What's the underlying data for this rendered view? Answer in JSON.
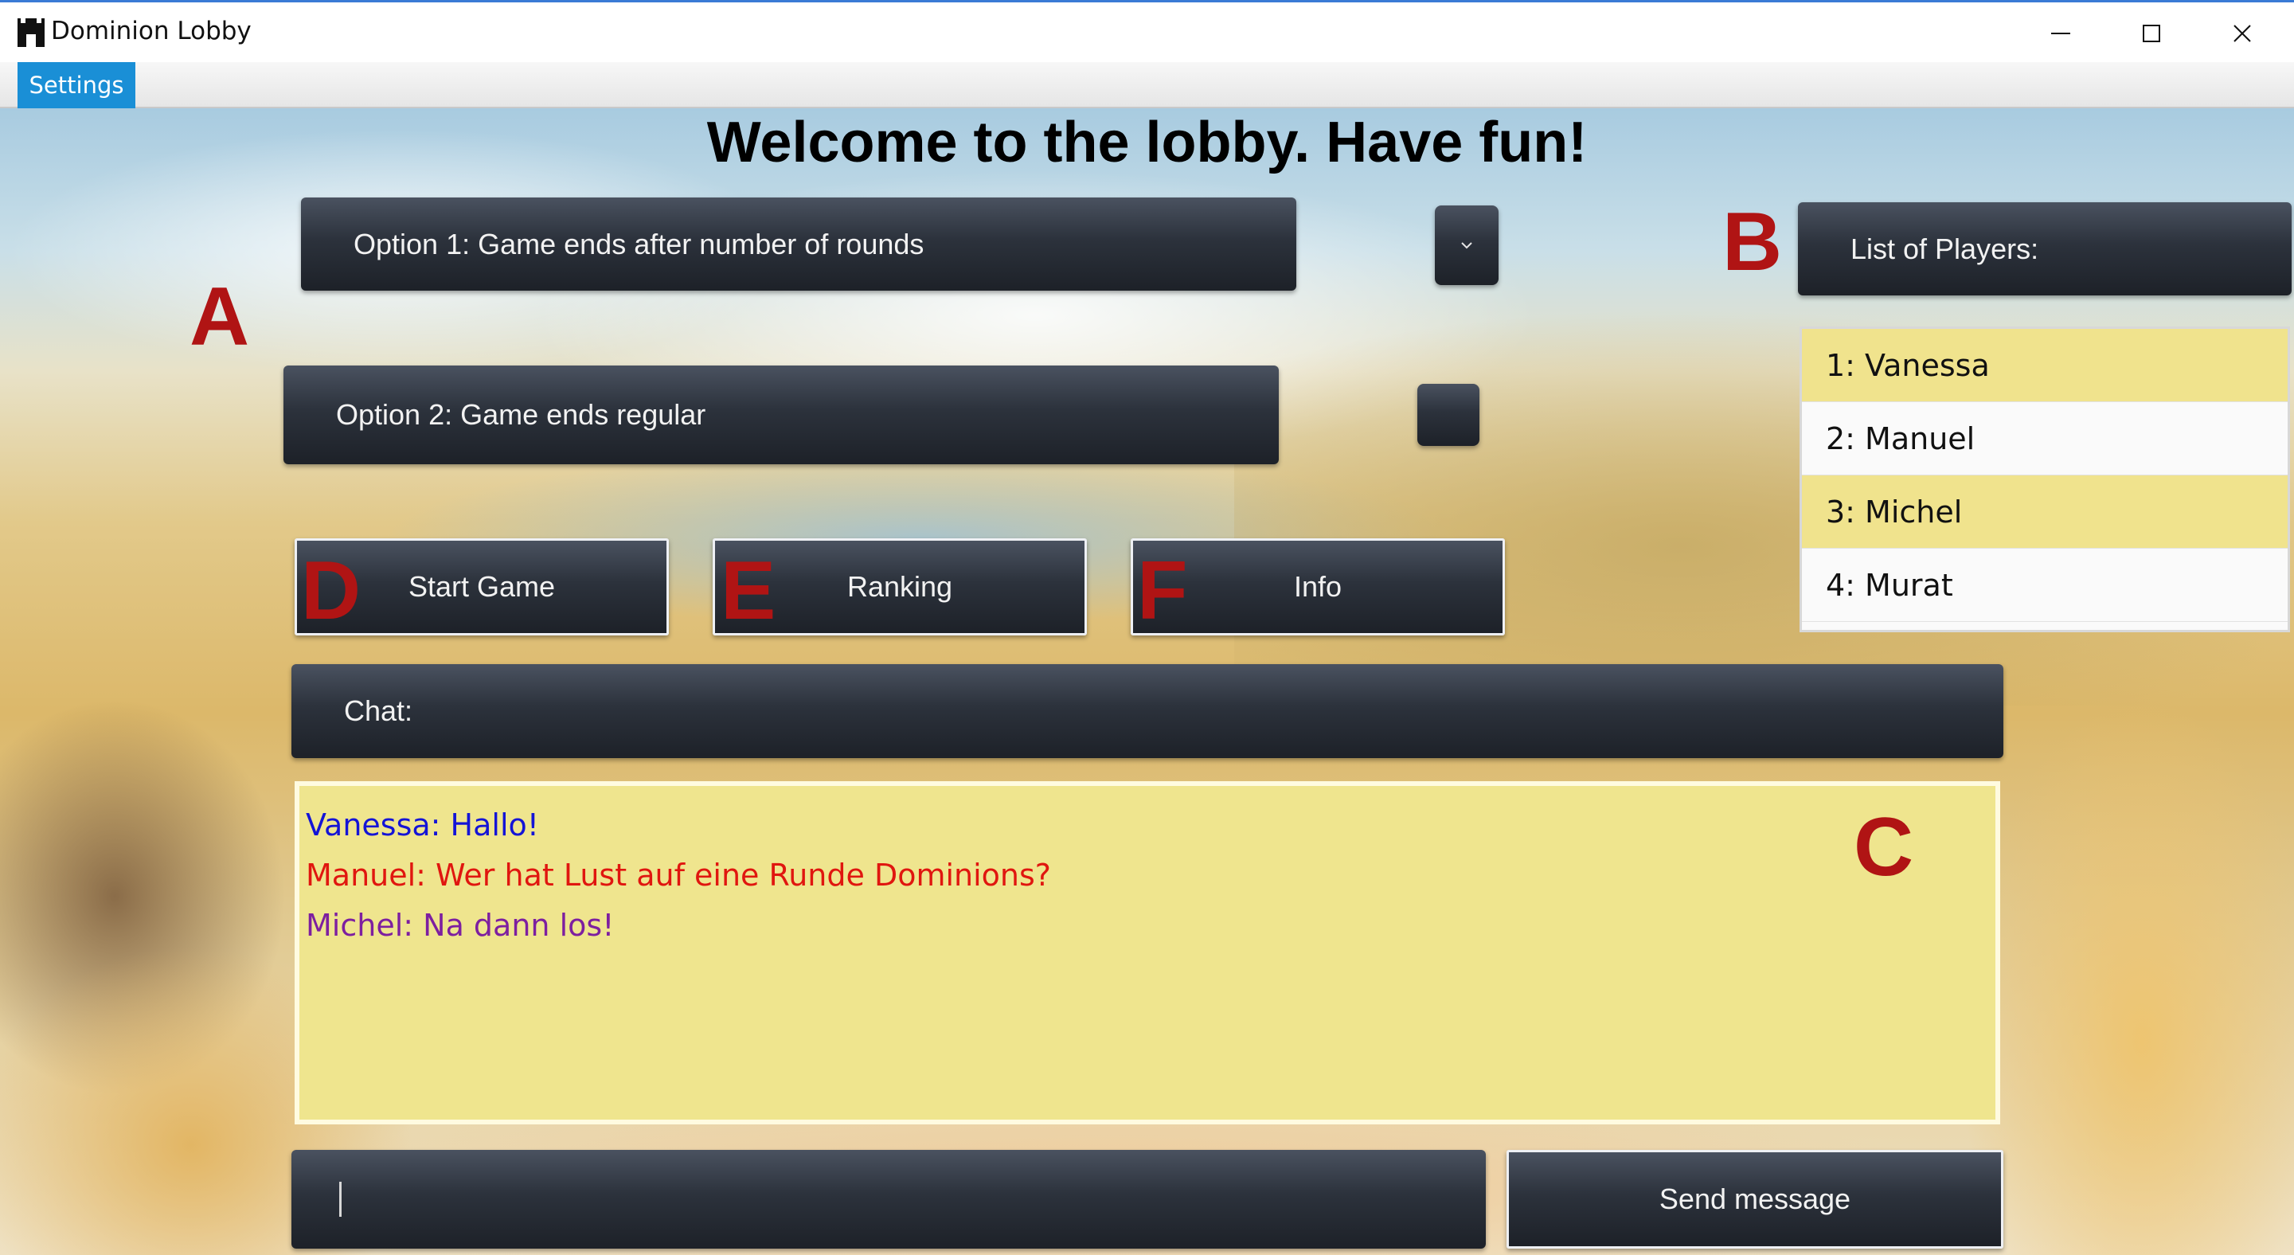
{
  "window": {
    "title": "Dominion Lobby",
    "controls": [
      "minimize-icon",
      "maximize-icon",
      "close-icon"
    ]
  },
  "menubar": {
    "settings_label": "Settings"
  },
  "heading": "Welcome to the lobby. Have fun!",
  "options": {
    "option1_label": "Option 1: Game ends after number of rounds",
    "option1_dropdown_icon": "chevron-down-icon",
    "option2_label": "Option 2: Game ends regular"
  },
  "players": {
    "header": "List of Players:",
    "items": [
      {
        "label": "1: Vanessa",
        "highlighted": true
      },
      {
        "label": "2: Manuel",
        "highlighted": false
      },
      {
        "label": "3: Michel",
        "highlighted": true
      },
      {
        "label": "4: Murat",
        "highlighted": false
      }
    ]
  },
  "buttons": {
    "start": "Start Game",
    "ranking": "Ranking",
    "info": "Info",
    "send": "Send message"
  },
  "chat": {
    "header": "Chat:",
    "input_value": "",
    "messages": [
      {
        "text": "Vanessa: Hallo!",
        "color": "#1414d6"
      },
      {
        "text": "Manuel: Wer hat Lust auf eine Runde Dominions?",
        "color": "#e0160f"
      },
      {
        "text": "Michel: Na dann los!",
        "color": "#7d1fa0"
      }
    ]
  },
  "annotations": {
    "A": "A",
    "B": "B",
    "C": "C",
    "D": "D",
    "E": "E",
    "F": "F",
    "color": "#b01414"
  },
  "colors": {
    "accent_menu": "#1a8fd6",
    "highlight_row": "#f0e38d",
    "chat_background": "#efe58e"
  }
}
